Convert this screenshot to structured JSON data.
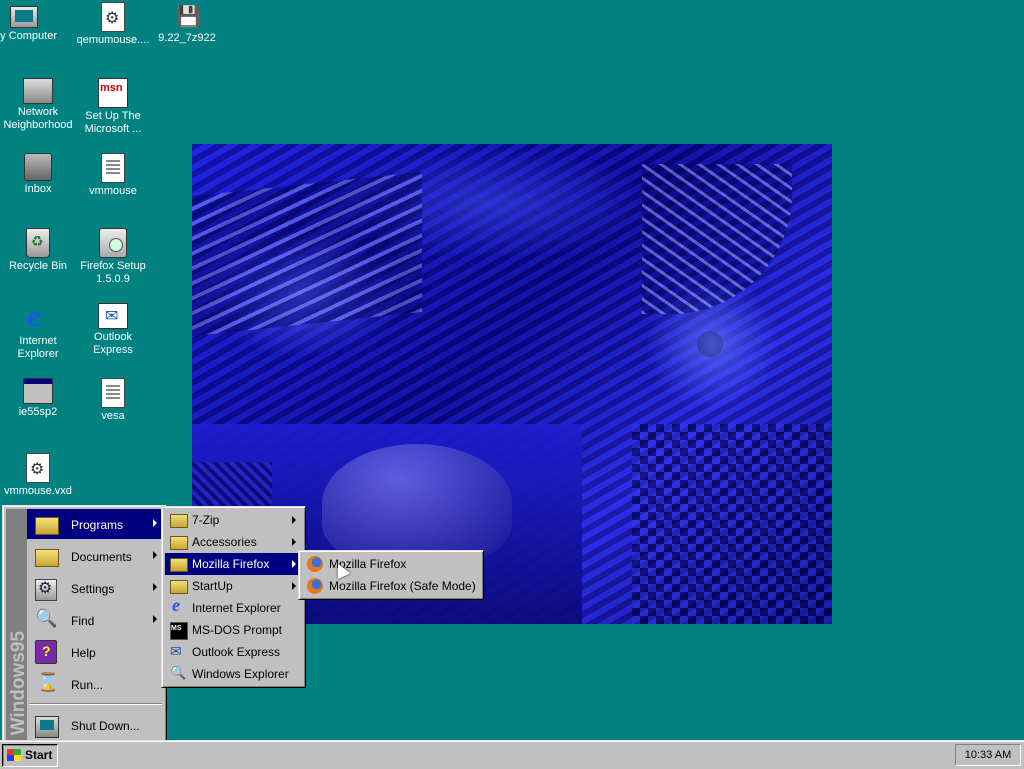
{
  "desktop_icons": [
    {
      "label": "My Computer",
      "icon": "computer-icon"
    },
    {
      "label": "qemumouse....",
      "icon": "gear-file-icon"
    },
    {
      "label": "9.22_7z922",
      "icon": "installer-icon"
    },
    {
      "label": "Network Neighborhood",
      "icon": "network-icon"
    },
    {
      "label": "Set Up The Microsoft ...",
      "icon": "msn-icon"
    },
    {
      "label": "Inbox",
      "icon": "inbox-icon"
    },
    {
      "label": "vmmouse",
      "icon": "document-icon"
    },
    {
      "label": "Recycle Bin",
      "icon": "recycle-bin-icon"
    },
    {
      "label": "Firefox Setup 1.5.0.9",
      "icon": "setup-icon"
    },
    {
      "label": "Internet Explorer",
      "icon": "internet-explorer-icon"
    },
    {
      "label": "Outlook Express",
      "icon": "outlook-express-icon"
    },
    {
      "label": "ie55sp2",
      "icon": "program-icon"
    },
    {
      "label": "vesa",
      "icon": "document-icon"
    },
    {
      "label": "vmmouse.vxd",
      "icon": "gear-file-icon"
    }
  ],
  "start_menu": {
    "banner": "Windows95",
    "items": [
      {
        "label": "Programs",
        "submenu": true
      },
      {
        "label": "Documents",
        "submenu": true
      },
      {
        "label": "Settings",
        "submenu": true
      },
      {
        "label": "Find",
        "submenu": true
      },
      {
        "label": "Help",
        "submenu": false
      },
      {
        "label": "Run...",
        "submenu": false
      },
      {
        "label": "Shut Down...",
        "submenu": false
      }
    ]
  },
  "programs_menu": {
    "items": [
      {
        "label": "7-Zip",
        "submenu": true
      },
      {
        "label": "Accessories",
        "submenu": true
      },
      {
        "label": "Mozilla Firefox",
        "submenu": true
      },
      {
        "label": "StartUp",
        "submenu": true
      },
      {
        "label": "Internet Explorer",
        "submenu": false
      },
      {
        "label": "MS-DOS Prompt",
        "submenu": false
      },
      {
        "label": "Outlook Express",
        "submenu": false
      },
      {
        "label": "Windows Explorer",
        "submenu": false
      }
    ]
  },
  "firefox_menu": {
    "items": [
      {
        "label": "Mozilla Firefox"
      },
      {
        "label": "Mozilla Firefox (Safe Mode)"
      }
    ]
  },
  "taskbar": {
    "start_label": "Start",
    "clock": "10:33 AM"
  },
  "colors": {
    "desktop": "#018281",
    "highlight": "#000080",
    "menu": "#c0c0c0"
  }
}
